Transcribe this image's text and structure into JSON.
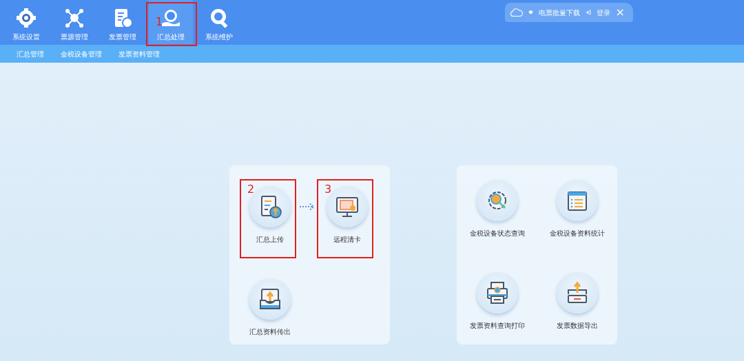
{
  "top_tabs": [
    {
      "label": "系统设置",
      "selected": false
    },
    {
      "label": "票源管理",
      "selected": false
    },
    {
      "label": "发票管理",
      "selected": false
    },
    {
      "label": "汇总处理",
      "selected": true,
      "annotation": "1"
    },
    {
      "label": "系统维护",
      "selected": false
    }
  ],
  "top_right": {
    "download": "电票批量下载",
    "login": "登录",
    "close": "×"
  },
  "sub_nav": [
    "汇总管理",
    "金税设备管理",
    "发票资料管理"
  ],
  "left_panel": {
    "row_1": [
      {
        "label": "汇总上传",
        "annotation": "2"
      },
      {
        "label": "远程清卡",
        "annotation": "3"
      }
    ],
    "row_2": [
      {
        "label": "汇总资料传出"
      }
    ]
  },
  "right_panel": {
    "items": [
      {
        "label": "金税设备状态查询"
      },
      {
        "label": "金税设备资料统计"
      },
      {
        "label": "发票资料查询打印"
      },
      {
        "label": "发票数据导出"
      }
    ]
  }
}
